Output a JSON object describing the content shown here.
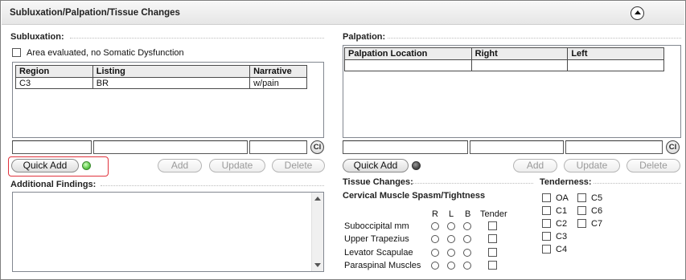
{
  "panel": {
    "title": "Subluxation/Palpation/Tissue Changes"
  },
  "subluxation": {
    "heading": "Subluxation:",
    "area_evaluated_label": "Area evaluated, no Somatic Dysfunction",
    "columns": [
      "Region",
      "Listing",
      "Narrative"
    ],
    "rows": [
      {
        "region": "C3",
        "listing": "BR",
        "narrative": "w/pain"
      }
    ],
    "input_region": "",
    "input_listing": "",
    "input_narrative": "",
    "clear_label": "Cl",
    "quick_add_label": "Quick Add",
    "status_color": "#5fc94a",
    "add_label": "Add",
    "update_label": "Update",
    "delete_label": "Delete"
  },
  "additional_findings": {
    "heading": "Additional Findings:",
    "value": ""
  },
  "palpation": {
    "heading": "Palpation:",
    "columns": [
      "Palpation Location",
      "Right",
      "Left"
    ],
    "rows": [],
    "input_location": "",
    "input_right": "",
    "input_left": "",
    "clear_label": "Cl",
    "quick_add_label": "Quick Add",
    "status_color": "#4a4a4a",
    "add_label": "Add",
    "update_label": "Update",
    "delete_label": "Delete"
  },
  "tissue_changes": {
    "heading": "Tissue Changes:",
    "subheading": "Cervical Muscle Spasm/Tightness",
    "col_r": "R",
    "col_l": "L",
    "col_b": "B",
    "col_tender": "Tender",
    "muscles": [
      "Suboccipital mm",
      "Upper Trapezius",
      "Levator Scapulae",
      "Paraspinal Muscles"
    ]
  },
  "tenderness": {
    "heading": "Tenderness:",
    "col1": [
      "OA",
      "C1",
      "C2",
      "C3",
      "C4"
    ],
    "col2": [
      "C5",
      "C6",
      "C7"
    ]
  }
}
